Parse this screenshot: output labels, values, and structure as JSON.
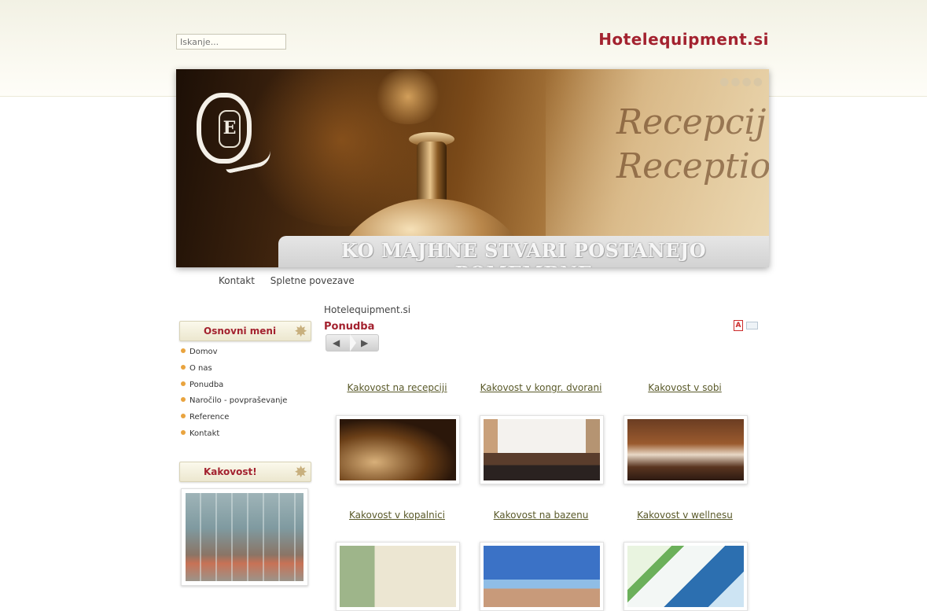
{
  "header": {
    "search_placeholder": "Iskanje...",
    "site_title": "Hotelequipment.si"
  },
  "banner": {
    "logo_letter": "E",
    "plate_text_1": "Recepcij",
    "plate_text_2": "Receptio",
    "caption": "KO MAJHNE STVARI POSTANEJO POMEMBNE"
  },
  "topnav": [
    "Kontakt",
    "Spletne povezave"
  ],
  "sidebar": {
    "menu_title": "Osnovni meni",
    "items": [
      "Domov",
      "O nas",
      "Ponudba",
      "Naročilo - povpraševanje",
      "Reference",
      "Kontakt"
    ],
    "quality_title": "Kakovost!"
  },
  "main": {
    "breadcrumb": "Hotelequipment.si",
    "heading": "Ponudba",
    "pdf_label": "A",
    "gallery": [
      "Kakovost na recepciji",
      "Kakovost v kongr. dvorani",
      "Kakovost v sobi",
      "Kakovost v kopalnici",
      "Kakovost na bazenu",
      "Kakovost v wellnesu"
    ]
  },
  "colors": {
    "brand": "#a3222f",
    "bullet": "#e9a43f",
    "link": "#5a5a2a"
  }
}
